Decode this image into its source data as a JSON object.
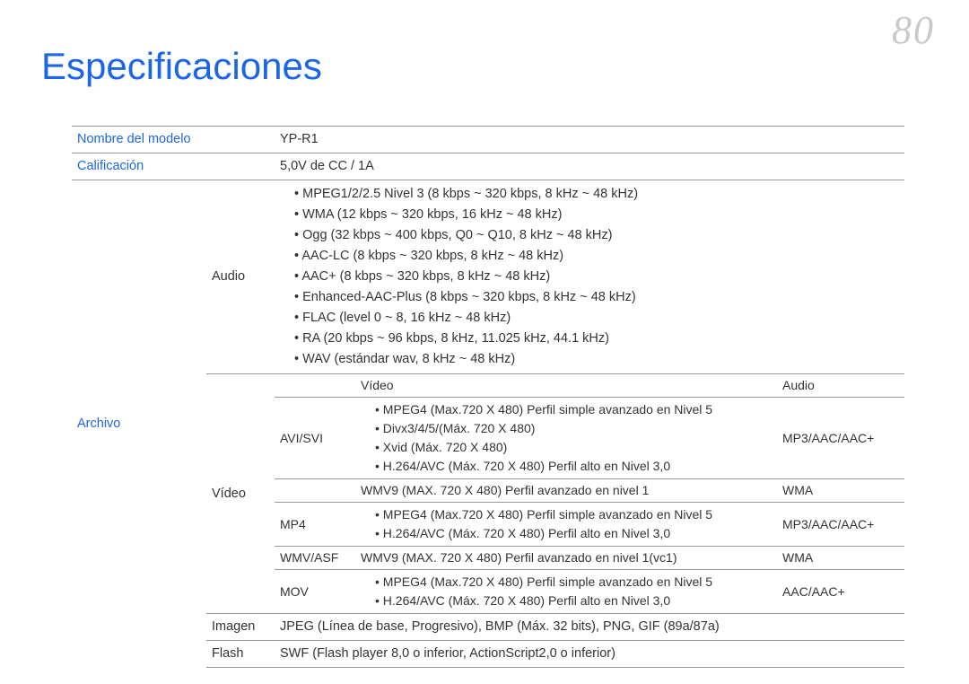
{
  "page_number": "80",
  "title": "Especificaciones",
  "rows": {
    "model_label": "Nombre del modelo",
    "model_value": "YP-R1",
    "rating_label": "Calificación",
    "rating_value": "5,0V de CC / 1A",
    "file_label": "Archivo",
    "audio_label": "Audio",
    "video_label": "Vídeo",
    "image_label": "Imagen",
    "image_value": "JPEG (Línea de base, Progresivo), BMP (Máx. 32 bits), PNG, GIF (89a/87a)",
    "flash_label": "Flash",
    "flash_value": "SWF (Flash player 8,0 o inferior, ActionScript2,0 o inferior)"
  },
  "audio_list": [
    "MPEG1/2/2.5 Nivel 3 (8 kbps ~ 320 kbps, 8 kHz ~ 48 kHz)",
    "WMA (12 kbps ~ 320 kbps, 16 kHz ~ 48 kHz)",
    "Ogg (32 kbps ~ 400 kbps, Q0 ~ Q10, 8 kHz ~ 48 kHz)",
    "AAC-LC (8 kbps ~ 320 kbps, 8 kHz ~ 48 kHz)",
    "AAC+ (8 kbps ~ 320 kbps, 8 kHz ~ 48 kHz)",
    "Enhanced-AAC-Plus (8 kbps ~ 320 kbps, 8 kHz ~ 48 kHz)",
    "FLAC (level 0 ~ 8, 16 kHz ~ 48 kHz)",
    "RA (20 kbps ~ 96 kbps, 8 kHz, 11.025 kHz, 44.1 kHz)",
    "WAV (estándar wav, 8 kHz ~ 48 kHz)"
  ],
  "video_table": {
    "head_container": "",
    "head_video": "Vídeo",
    "head_audio": "Audio",
    "rows": [
      {
        "container": "AVI/SVI",
        "video": [
          "MPEG4 (Max.720 X 480) Perfil simple avanzado en Nivel 5",
          "Divx3/4/5/(Máx. 720 X 480)",
          "Xvid (Máx. 720 X 480)",
          "H.264/AVC (Máx. 720 X 480) Perfil alto en Nivel 3,0"
        ],
        "audio": "MP3/AAC/AAC+"
      },
      {
        "container": "",
        "video": [
          "WMV9 (MAX. 720 X 480) Perfil avanzado en nivel 1"
        ],
        "audio": "WMA"
      },
      {
        "container": "MP4",
        "video": [
          "MPEG4 (Max.720 X 480) Perfil simple avanzado en Nivel 5",
          "H.264/AVC (Máx. 720 X 480) Perfil alto en Nivel 3,0"
        ],
        "audio": "MP3/AAC/AAC+"
      },
      {
        "container": "WMV/ASF",
        "video": [
          "WMV9 (MAX. 720 X 480) Perfil avanzado en nivel 1(vc1)"
        ],
        "audio": "WMA"
      },
      {
        "container": "MOV",
        "video": [
          "MPEG4 (Max.720 X 480) Perfil simple avanzado en Nivel 5",
          "H.264/AVC (Máx. 720 X 480) Perfil alto en Nivel 3,0"
        ],
        "audio": "AAC/AAC+"
      }
    ]
  }
}
